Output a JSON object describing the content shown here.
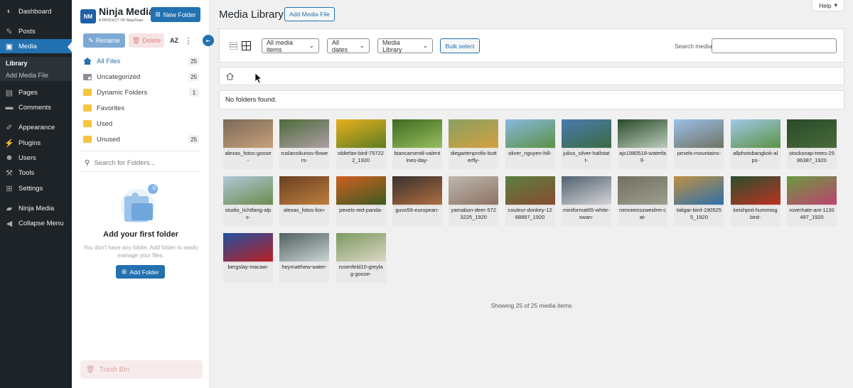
{
  "admin_menu": {
    "items": [
      {
        "label": "Dashboard",
        "icon": "dashboard-icon"
      },
      {
        "label": "Posts",
        "icon": "pin-icon"
      },
      {
        "label": "Media",
        "icon": "media-icon"
      },
      {
        "label": "Pages",
        "icon": "pages-icon"
      },
      {
        "label": "Comments",
        "icon": "comment-icon"
      },
      {
        "label": "Appearance",
        "icon": "brush-icon"
      },
      {
        "label": "Plugins",
        "icon": "plug-icon"
      },
      {
        "label": "Users",
        "icon": "user-icon"
      },
      {
        "label": "Tools",
        "icon": "wrench-icon"
      },
      {
        "label": "Settings",
        "icon": "settings-icon"
      },
      {
        "label": "Ninja Media",
        "icon": "folder-icon"
      },
      {
        "label": "Collapse Menu",
        "icon": "collapse-icon"
      }
    ],
    "media_sub": [
      "Library",
      "Add Media File"
    ]
  },
  "folder_panel": {
    "logo_title": "Ninja Media",
    "logo_sub": "A PRODUCT OF NinjaTeam",
    "new_folder": "New Folder",
    "rename": "Rename",
    "delete": "Delete",
    "sort": "AZ",
    "folders": [
      {
        "label": "All Files",
        "count": "25"
      },
      {
        "label": "Uncategorized",
        "count": "25"
      },
      {
        "label": "Dynamic Folders",
        "count": "1"
      },
      {
        "label": "Favorites",
        "count": ""
      },
      {
        "label": "Used",
        "count": ""
      },
      {
        "label": "Unused",
        "count": "25"
      }
    ],
    "search_placeholder": "Search for Folders...",
    "empty_badge": "0",
    "empty_title": "Add your first folder",
    "empty_desc": "You don't have any folder. Add folder to easily manage your files.",
    "add_folder": "Add Folder",
    "trash": "Trash Bin"
  },
  "main": {
    "help": "Help",
    "title": "Media Library",
    "add_media": "Add Media File",
    "filter_type": "All media items",
    "filter_date": "All dates",
    "filter_library": "Media Library",
    "bulk_select": "Bulk select",
    "search_label": "Search media",
    "no_folders": "No folders found.",
    "showing": "Showing 25 of 25 media items"
  },
  "media": [
    {
      "cap": "alexas_fotos-goose-",
      "c1": "#7a6a58",
      "c2": "#c9a27a"
    },
    {
      "cap": "ruslansikunov-flowers-",
      "c1": "#4d6b3a",
      "c2": "#b0a0a8"
    },
    {
      "cap": "oldiefan-bird-757222_1920",
      "c1": "#e8b020",
      "c2": "#5a7a20"
    },
    {
      "cap": "biancamentil-valentines-day-",
      "c1": "#3f6a20",
      "c2": "#9ac060"
    },
    {
      "cap": "diegartenprofis-butterfly-",
      "c1": "#8aa060",
      "c2": "#d4a040"
    },
    {
      "cap": "oliver_nguyen-hill-",
      "c1": "#88b8e0",
      "c2": "#5a9040"
    },
    {
      "cap": "julius_silver-hallstatt-",
      "c1": "#4a7ab0",
      "c2": "#3a6a40"
    },
    {
      "cap": "ajs1980518-waterfall-",
      "c1": "#2a4a2a",
      "c2": "#c0d0c0"
    },
    {
      "cap": "pexels-mountains-",
      "c1": "#9ac0e8",
      "c2": "#707060"
    },
    {
      "cap": "allphotobangkok-alps-",
      "c1": "#a0c8e8",
      "c2": "#5a9040"
    },
    {
      "cap": "stocksnap-trees-2586387_1920",
      "c1": "#2a4a2a",
      "c2": "#4a6a3a"
    },
    {
      "cap": "studio_lichtfang-alps-",
      "c1": "#b0c8d8",
      "c2": "#6a8a4a"
    },
    {
      "cap": "alexas_fotos-lion-",
      "c1": "#6a4020",
      "c2": "#c08040"
    },
    {
      "cap": "pexels-red-panda-",
      "c1": "#d06020",
      "c2": "#3a5a20"
    },
    {
      "cap": "guvo59-european-",
      "c1": "#3a3030",
      "c2": "#b07040"
    },
    {
      "cap": "yamabon-deer-5723225_1920",
      "c1": "#c0b8b0",
      "c2": "#8a7060"
    },
    {
      "cap": "couleur-donkey-1268897_1920",
      "c1": "#5a8040",
      "c2": "#8a4a30"
    },
    {
      "cap": "miniformat65-white-swan-",
      "c1": "#506070",
      "c2": "#d8d8d8"
    },
    {
      "cap": "nennieinszweidrei-cat-",
      "c1": "#707060",
      "c2": "#a0a090"
    },
    {
      "cap": "taligar-bird-1905255_1920",
      "c1": "#c09040",
      "c2": "#2a70b0"
    },
    {
      "cap": "keishpixl-hummingbird-",
      "c1": "#2a5030",
      "c2": "#c03020"
    },
    {
      "cap": "roverhate-ant-1130497_1920",
      "c1": "#6a9a40",
      "c2": "#c04070"
    },
    {
      "cap": "bergslay-macaw-",
      "c1": "#2050a0",
      "c2": "#c02020"
    },
    {
      "cap": "heymatthew-water-",
      "c1": "#506060",
      "c2": "#d0d8d8"
    },
    {
      "cap": "rosenfeld10-greylag-goose-",
      "c1": "#7a9a60",
      "c2": "#e0d8c8"
    }
  ]
}
